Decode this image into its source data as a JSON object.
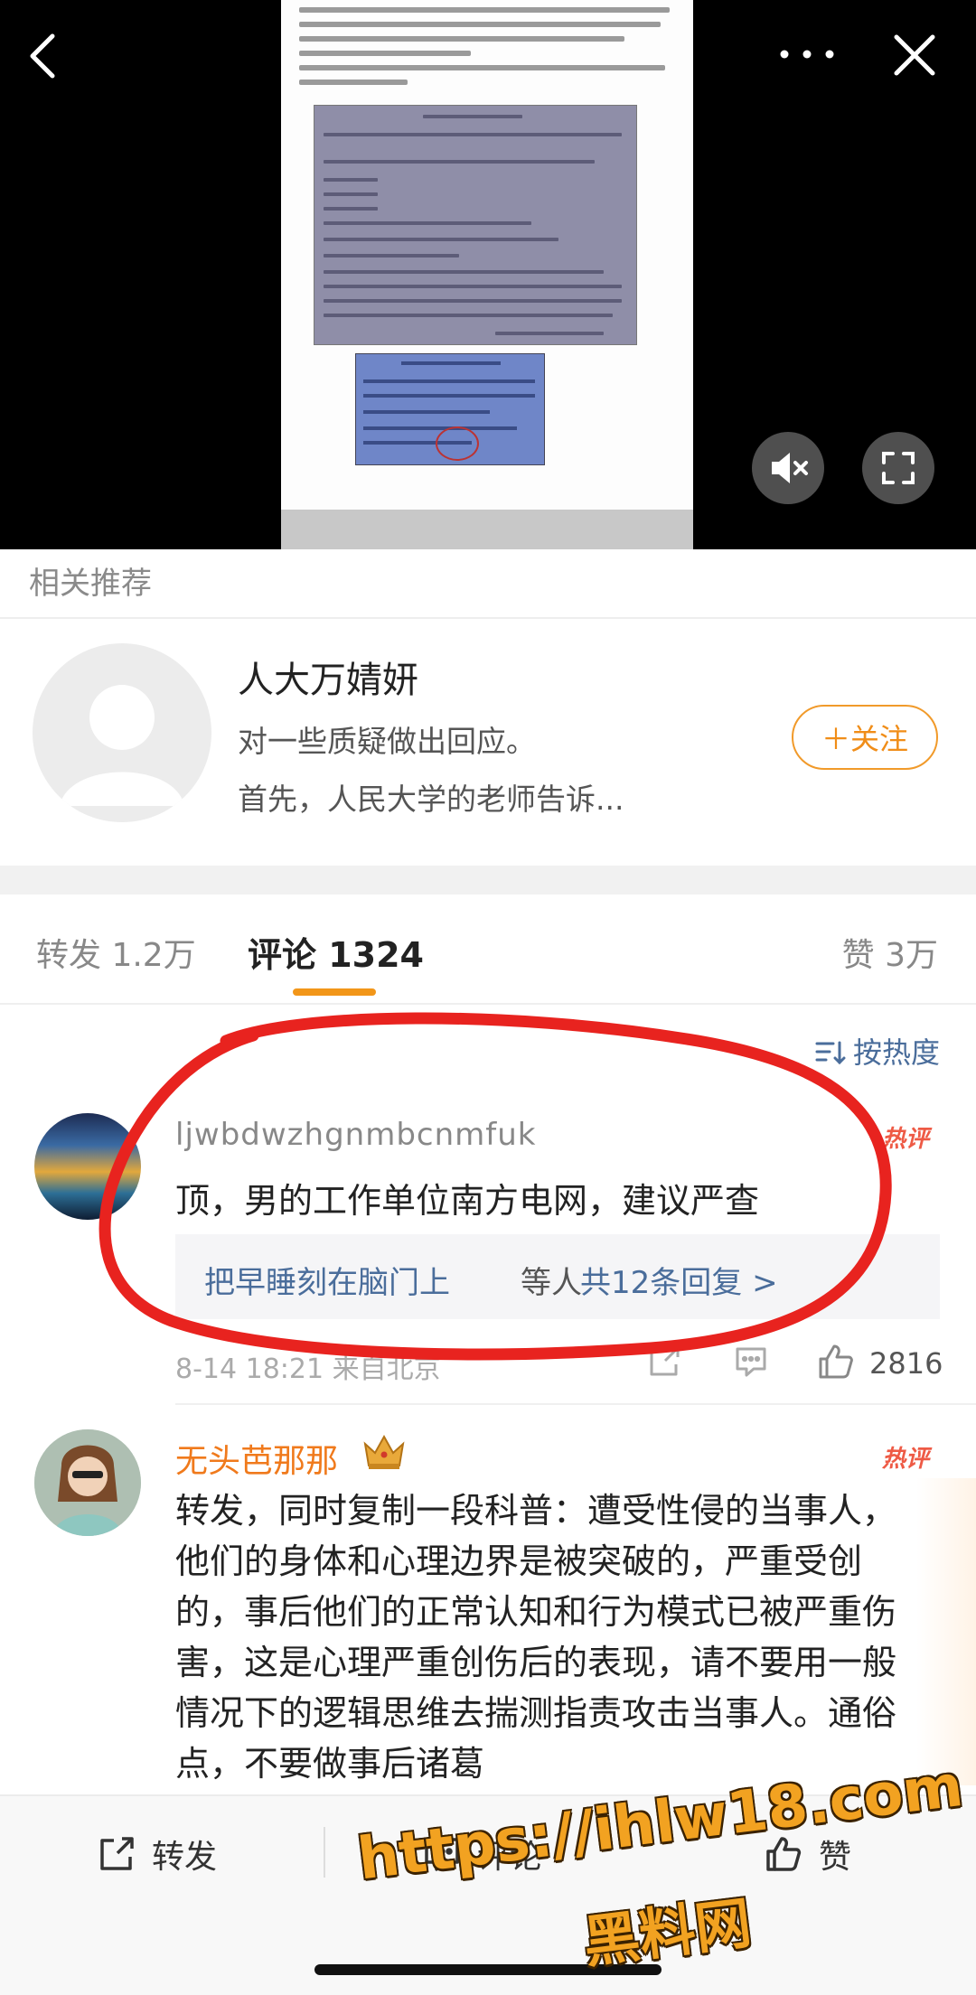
{
  "related": {
    "header": "相关推荐",
    "card": {
      "name": "人大万婧妍",
      "line1": "对一些质疑做出回应。",
      "line2": "首先，人民大学的老师告诉...",
      "follow_label": "＋关注"
    }
  },
  "tabs": {
    "repost": "转发 1.2万",
    "comment": "评论 1324",
    "like": "赞 3万"
  },
  "sort_label": "按热度",
  "comments": [
    {
      "user": "ljwbdwzhgnmbcnmfuk",
      "hot_label": "热评",
      "text": "顶，男的工作单位南方电网，建议严查",
      "reply_user": "把早睡刻在脑门上",
      "reply_etc": "等人",
      "reply_total": "共12条回复 >",
      "meta": "8-14 18:21 来自北京",
      "likes": "2816"
    },
    {
      "user": "无头芭那那",
      "hot_label": "热评",
      "text": "转发，同时复制一段科普：遭受性侵的当事人，他们的身体和心理边界是被突破的，严重受创的，事后他们的正常认知和行为模式已被严重伤害，这是心理严重创伤后的表现，请不要用一般情况下的逻辑思维去揣测指责攻击当事人。通俗点，不要做事后诸葛"
    }
  ],
  "bottom_bar": {
    "repost": "转发",
    "comment": "评论",
    "like": "赞"
  },
  "watermark": {
    "url": "https://ihlw18.com",
    "name": "黑料网"
  },
  "colors": {
    "accent_orange": "#f29619",
    "link_blue": "#4a6d9b",
    "hot_red": "#ee5a45",
    "annotation_red": "#e8231f"
  },
  "icons": [
    "back-icon",
    "more-icon",
    "close-icon",
    "mute-icon",
    "fullscreen-icon",
    "sort-icon",
    "share-icon",
    "comment-icon",
    "like-icon",
    "crown-icon"
  ]
}
